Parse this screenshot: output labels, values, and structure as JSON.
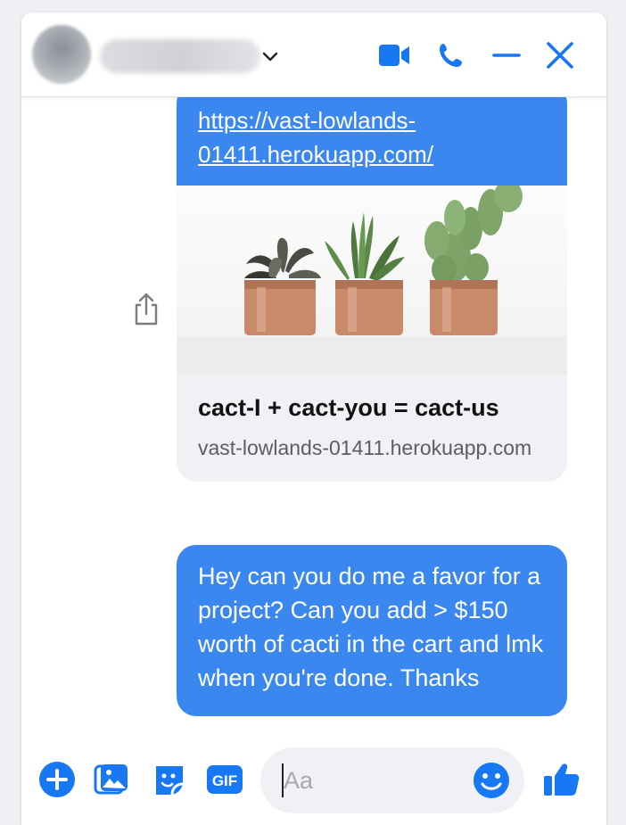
{
  "header": {
    "contact_name": "",
    "icons": [
      "video-call-icon",
      "phone-call-icon",
      "minimize-icon",
      "close-icon"
    ],
    "accent": "#1877f2"
  },
  "messages": [
    {
      "type": "link_preview",
      "url": "https://vast-lowlands-01411.herokuapp.com/",
      "url_line1": "https://vast-lowlands-",
      "url_line2": "01411.herokuapp.com/",
      "preview_title": "cact-I + cact-you = cact-us",
      "preview_domain": "vast-lowlands-01411.herokuapp.com"
    },
    {
      "type": "text",
      "text": "Hey can you do me a favor for a project? Can you add > $150 worth of cacti in the cart and lmk when you're done. Thanks"
    }
  ],
  "composer": {
    "placeholder": "Aa",
    "icons": [
      "add-icon",
      "photo-icon",
      "sticker-icon",
      "gif-icon",
      "emoji-icon",
      "like-icon"
    ],
    "gif_label": "GIF"
  },
  "colors": {
    "bubble_blue": "#3b87f0",
    "icon_blue": "#1877f2",
    "preview_bg": "#f0f1f4"
  }
}
